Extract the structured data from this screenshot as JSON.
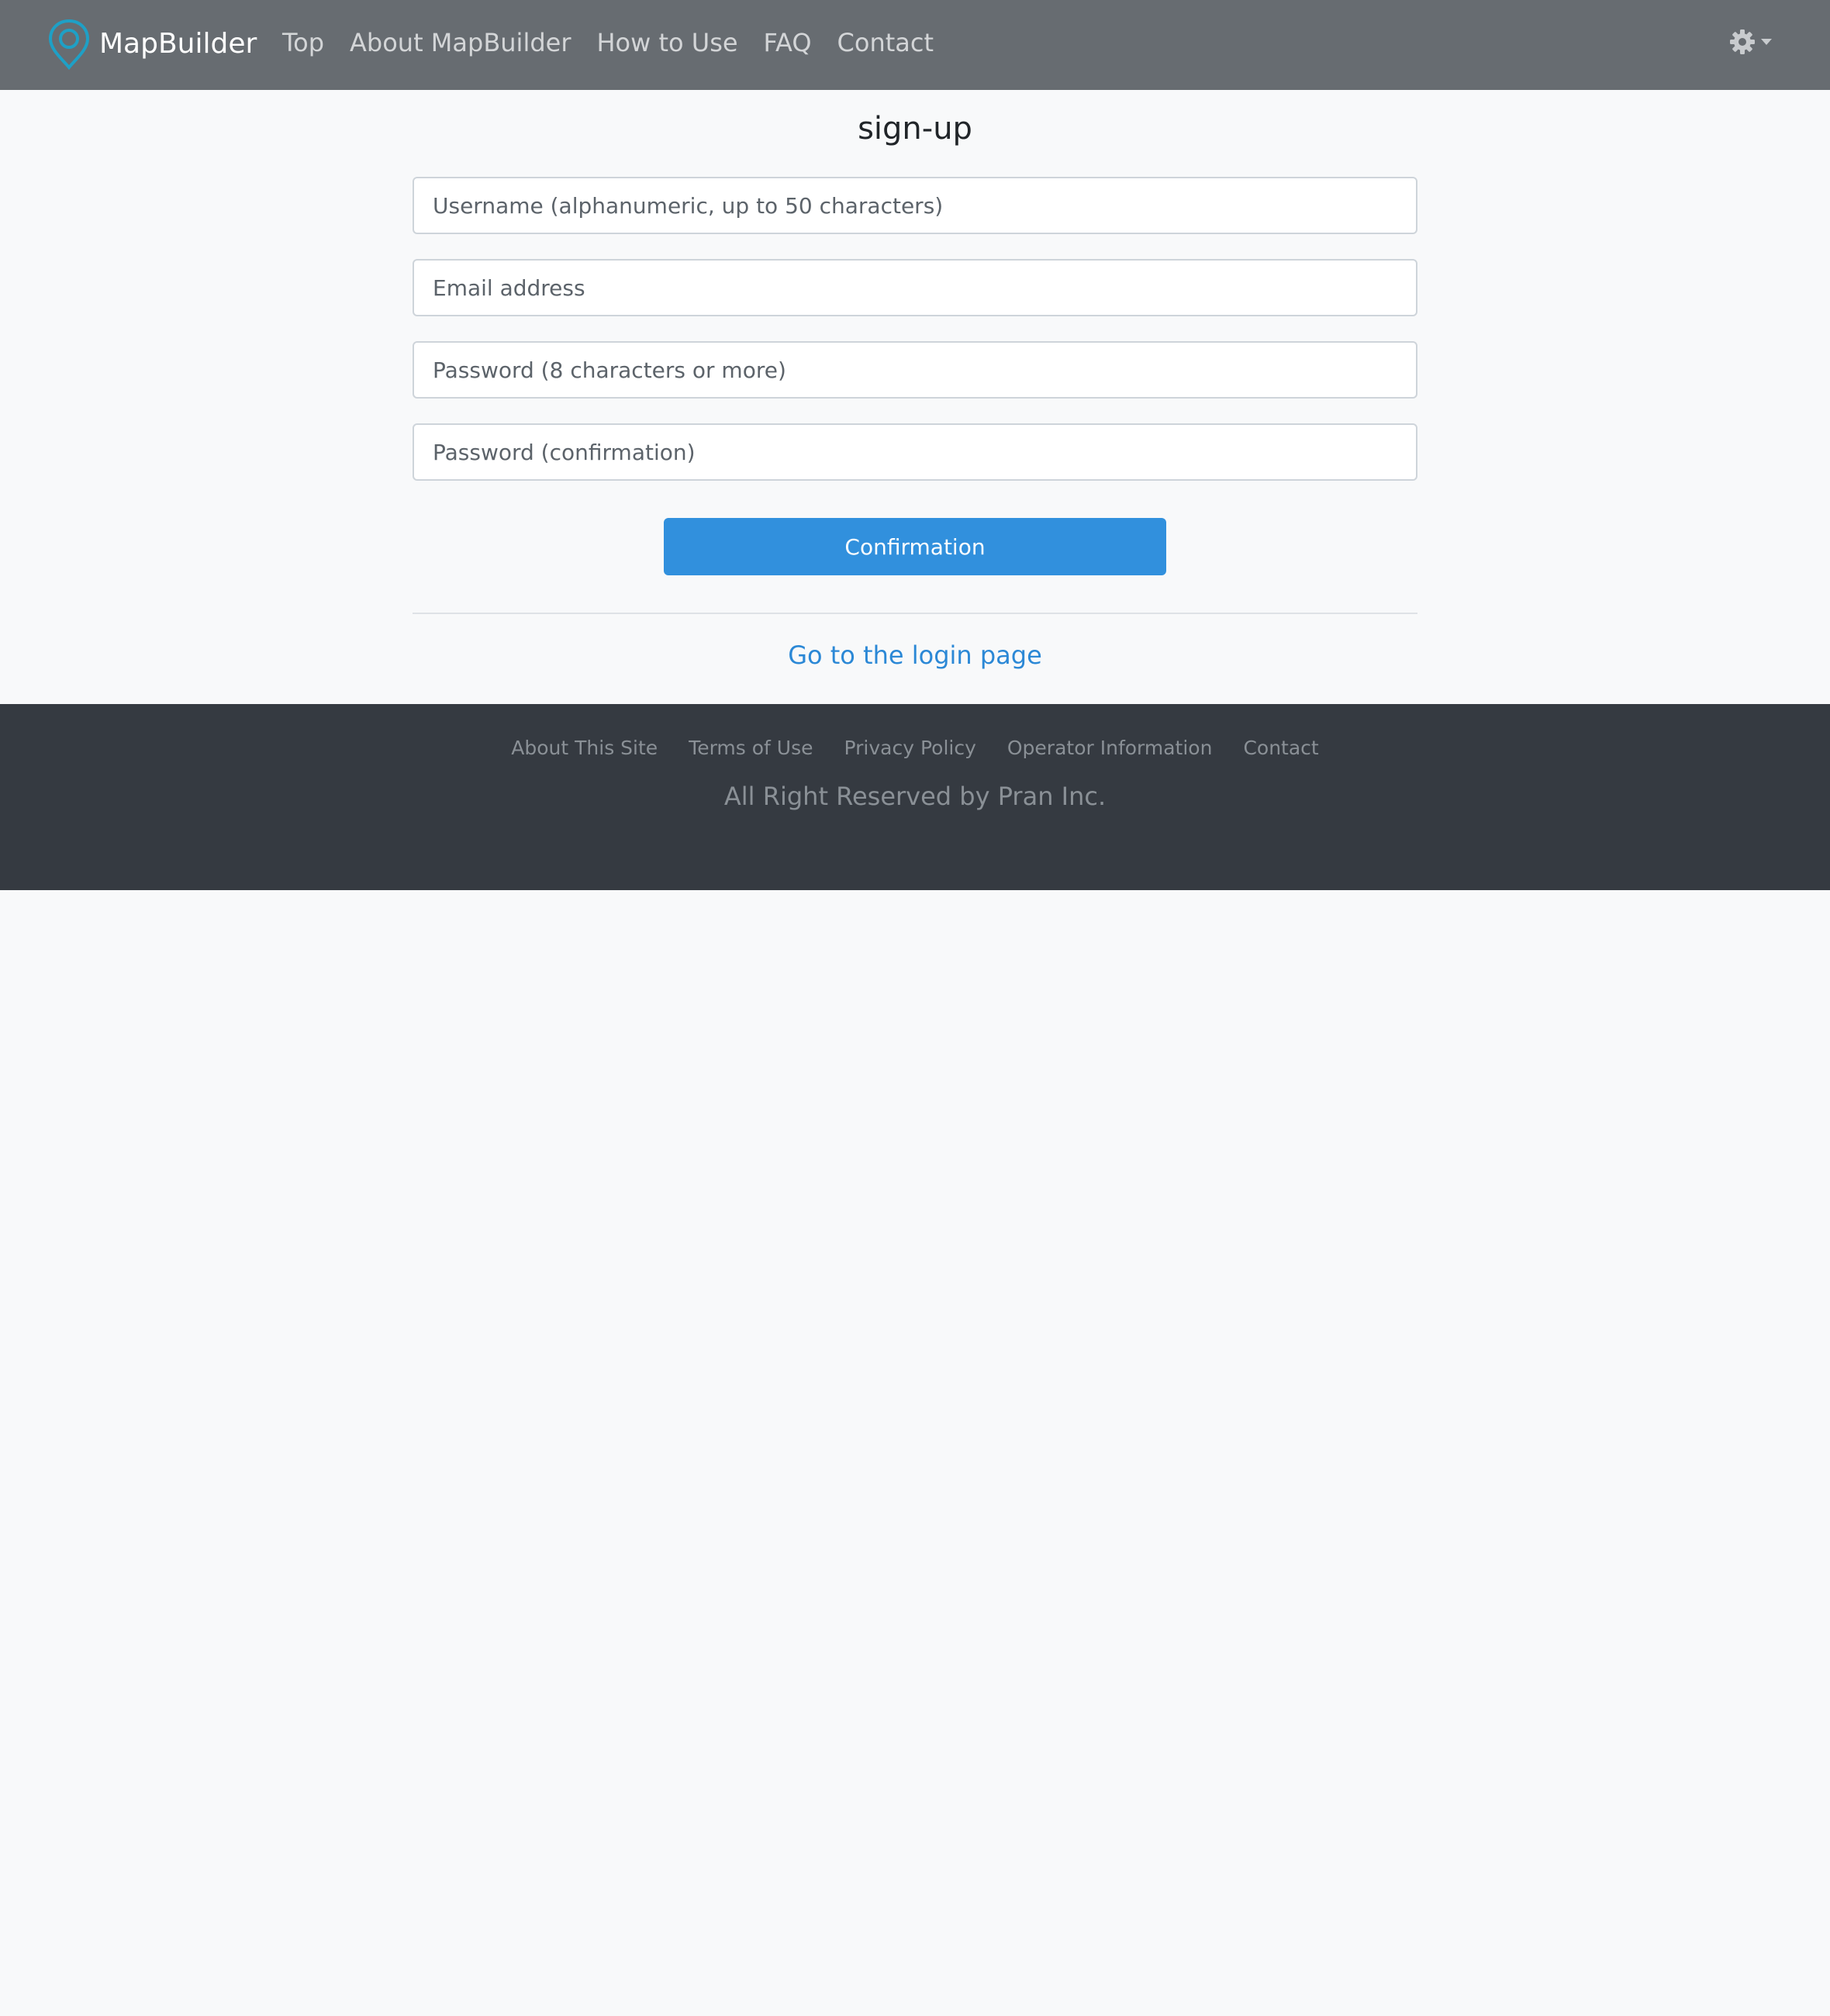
{
  "header": {
    "brand": "MapBuilder",
    "nav": [
      "Top",
      "About MapBuilder",
      "How to Use",
      "FAQ",
      "Contact"
    ],
    "settings_icon": "gear-icon"
  },
  "form": {
    "title": "sign-up",
    "username_placeholder": "Username (alphanumeric, up to 50 characters)",
    "email_placeholder": "Email address",
    "password_placeholder": "Password (8 characters or more)",
    "password_confirm_placeholder": "Password (confirmation)",
    "submit_label": "Confirmation",
    "login_link": "Go to the login page"
  },
  "footer": {
    "links": [
      "About This Site",
      "Terms of Use",
      "Privacy Policy",
      "Operator Information",
      "Contact"
    ],
    "copyright": "All Right Reserved by Pran Inc."
  },
  "colors": {
    "navbar": "#676c71",
    "brand_icon": "#1ea0c6",
    "primary": "#3190dd",
    "link": "#2b88d6",
    "footer": "#353a41",
    "page_background": "#f8f9fa"
  }
}
